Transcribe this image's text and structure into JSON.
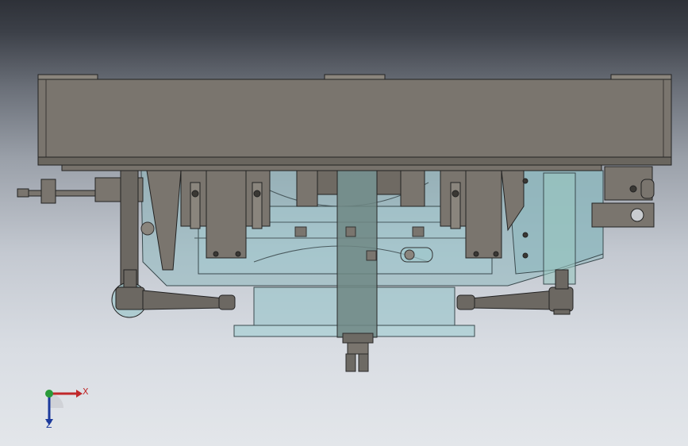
{
  "viewport": {
    "background_top": "#2e3138",
    "background_bottom": "#e3e6ea",
    "colors": {
      "solid_part": "#7a756e",
      "solid_part_dark": "#5a5650",
      "transparent_part": "#9ec6cc",
      "edge": "#2a2a2a"
    }
  },
  "triad": {
    "x_label": "X",
    "z_label": "Z",
    "x_color": "#c0282a",
    "y_color": "#2a9a3a",
    "z_color": "#1c3a9c"
  }
}
